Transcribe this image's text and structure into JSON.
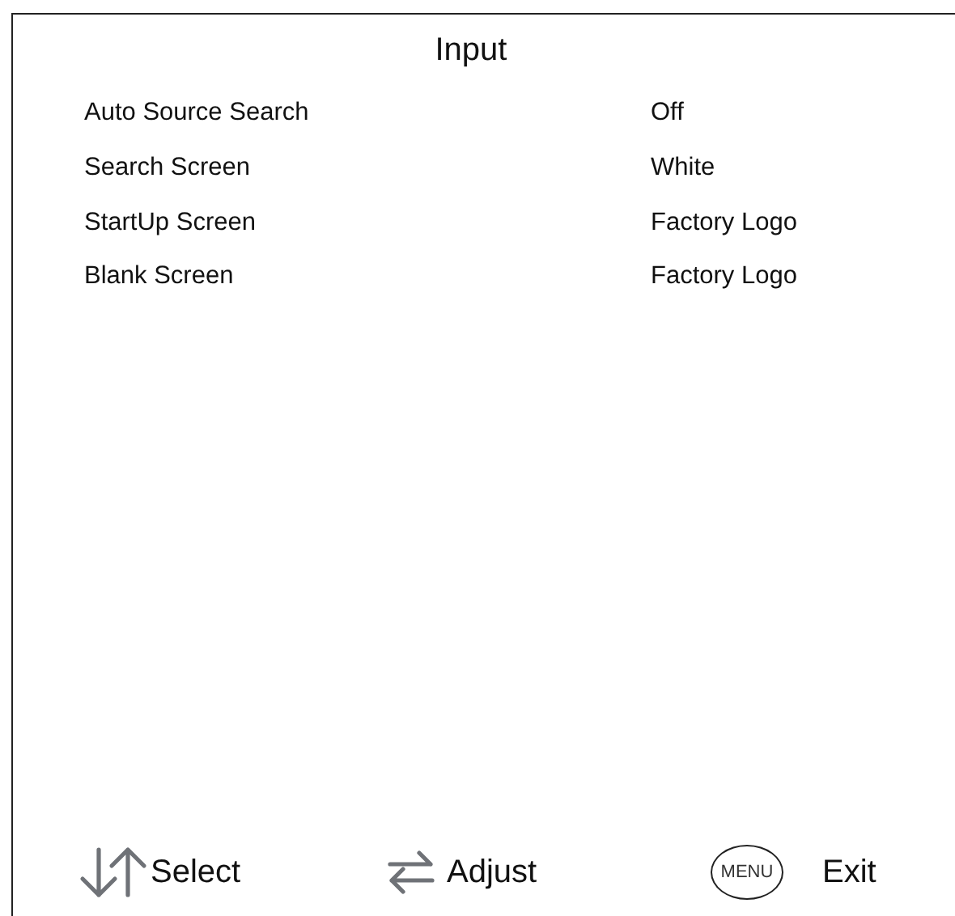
{
  "title": "Input",
  "settings": [
    {
      "label": "Auto Source Search",
      "value": "Off"
    },
    {
      "label": "Search Screen",
      "value": "White"
    },
    {
      "label": "StartUp Screen",
      "value": "Factory Logo"
    },
    {
      "label": "Blank Screen",
      "value": "Factory Logo"
    }
  ],
  "footer": [
    {
      "kind": "updown",
      "label": "Select"
    },
    {
      "kind": "leftright",
      "label": "Adjust"
    },
    {
      "kind": "key",
      "key": "MENU",
      "label": "Exit"
    }
  ]
}
